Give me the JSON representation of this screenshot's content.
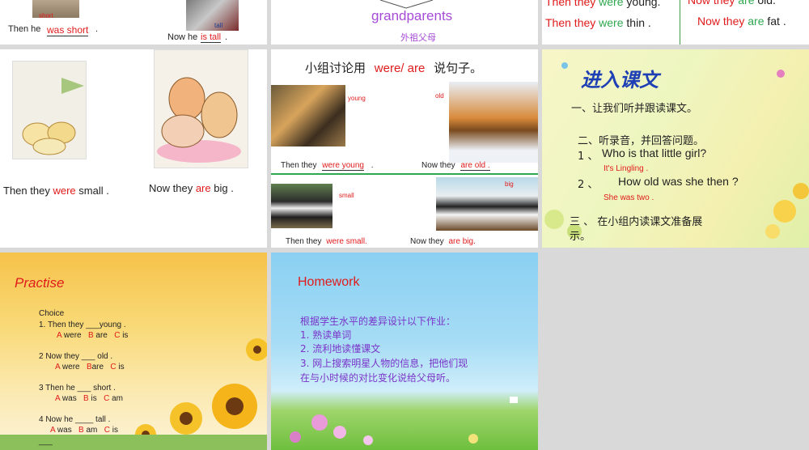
{
  "s1": {
    "short_tag": "short",
    "tall_tag": "tall",
    "then_he": "Then he",
    "was_short": "was short",
    "dot": ".",
    "now_he": "Now he",
    "is_tall": "is tall",
    "dot2": "."
  },
  "s2": {
    "title": "grandparents",
    "cn": "外祖父母"
  },
  "s3": {
    "then_prefix": "Then they",
    "were1": "were",
    "young": "young.",
    "then2_prefix": "Then they",
    "were2": "were",
    "thin": "thin  .",
    "now_prefix": "Now they",
    "are1": "are",
    "old": "old.",
    "now2_prefix": "Now they",
    "are2": "are",
    "fat": "fat ."
  },
  "s4": {
    "then_they": "Then they",
    "were": "were",
    "small": "small .",
    "now_they": "Now  they",
    "are": "are",
    "big": "big ."
  },
  "s5": {
    "heading_a": "小组讨论用",
    "heading_b": "were/ are",
    "heading_c": "说句子。",
    "young": "young",
    "old": "old",
    "small": "small",
    "big": "big",
    "then_they_1": "Then they",
    "were_young": "were young",
    "dot1": ".",
    "now_they_1": "Now they",
    "are_old": "are old .",
    "then_they_2": "Then they",
    "were_small": "were small.",
    "now_they_2": "Now they",
    "are_big": "are big."
  },
  "s6": {
    "title": "进入课文",
    "item1": "一、让我们听并跟读课文。",
    "item2": "二、听录音，并回答问题。",
    "q1_num": "1 、",
    "q1": "Who is that little girl?",
    "a1": "It's Lingling .",
    "q2_num": "2 、",
    "q2": "How old was she then ?",
    "a2": "She was two .",
    "item3_a": "三 、 在小组内读课文准备展",
    "item3_b": "示。"
  },
  "s7": {
    "title": "Practise",
    "choice": "Choice",
    "q1": "1. Then  they ___young  .",
    "q1_opts": {
      "a": "A",
      "a_t": "were",
      "b": "B",
      "b_t": "are",
      "c": "C",
      "c_t": "is"
    },
    "q2": "2  Now they ___ old  .",
    "q2_opts": {
      "a": "A",
      "a_t": "were",
      "b": "B",
      "b_t": "are",
      "c": "C",
      "c_t": "is"
    },
    "q3": "3  Then he ___  short  .",
    "q3_opts": {
      "a": "A",
      "a_t": "was",
      "b": "B",
      "b_t": "is",
      "c": "C",
      "c_t": "am"
    },
    "q4": "4  Now he ____  tall  .",
    "q4_opts": {
      "a": "A",
      "a_t": "was",
      "b": "B",
      "b_t": "am",
      "c": "C",
      "c_t": "is"
    },
    "trail": "___"
  },
  "s8": {
    "title": "Homework",
    "line0": "根据学生水平的差异设计以下作业：",
    "line1": "1. 熟读单词",
    "line2": "2. 流利地读懂课文",
    "line3": "3. 网上搜索明星人物的信息，把他们现",
    "line4": "在与小时候的对比变化说给父母听。"
  },
  "colors": {
    "red": "#e01b1b",
    "green": "#2fa84f",
    "purple": "#a64bd6",
    "blue_title": "#1f3fb5",
    "homework_purple": "#7a35c9"
  }
}
